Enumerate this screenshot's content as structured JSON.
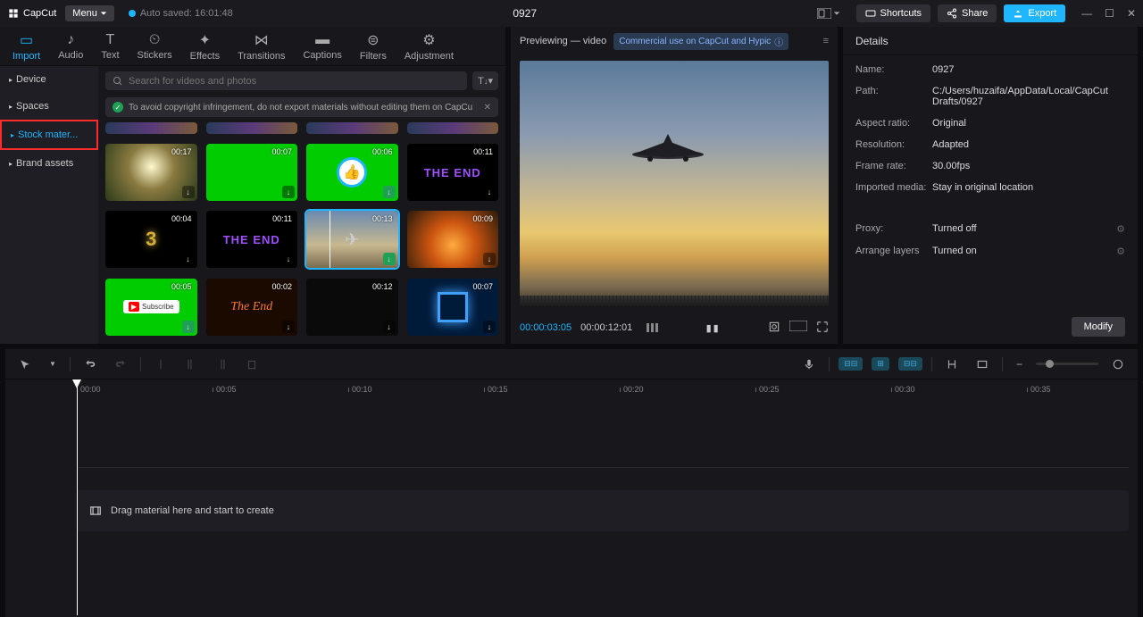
{
  "app": {
    "name": "CapCut"
  },
  "menu_label": "Menu",
  "autosave": "Auto saved: 16:01:48",
  "project_title": "0927",
  "top": {
    "shortcuts": "Shortcuts",
    "share": "Share",
    "export": "Export"
  },
  "tabs": [
    {
      "label": "Import",
      "active": true
    },
    {
      "label": "Audio"
    },
    {
      "label": "Text"
    },
    {
      "label": "Stickers"
    },
    {
      "label": "Effects"
    },
    {
      "label": "Transitions"
    },
    {
      "label": "Captions"
    },
    {
      "label": "Filters"
    },
    {
      "label": "Adjustment"
    }
  ],
  "sidebar": [
    {
      "label": "Device"
    },
    {
      "label": "Spaces"
    },
    {
      "label": "Stock mater...",
      "active": true,
      "highlighted": true
    },
    {
      "label": "Brand assets"
    }
  ],
  "search_placeholder": "Search for videos and photos",
  "copyright_warning": "To avoid copyright infringement, do not export materials without editing them on CapCu",
  "thumbs": [
    {
      "duration": "",
      "kind": "top-strip"
    },
    {
      "duration": "",
      "kind": "top-strip"
    },
    {
      "duration": "",
      "kind": "top-strip"
    },
    {
      "duration": "",
      "kind": "top-strip"
    },
    {
      "duration": "00:17",
      "kind": "forest"
    },
    {
      "duration": "00:07",
      "kind": "green"
    },
    {
      "duration": "00:06",
      "kind": "like",
      "dl_done": true
    },
    {
      "duration": "00:11",
      "kind": "theend-purple"
    },
    {
      "duration": "00:04",
      "kind": "countdown"
    },
    {
      "duration": "00:11",
      "kind": "theend-purple"
    },
    {
      "duration": "00:13",
      "kind": "airplane",
      "selected": true,
      "dl_done": true
    },
    {
      "duration": "00:09",
      "kind": "explosion"
    },
    {
      "duration": "00:05",
      "kind": "subscribe",
      "dl_done": true
    },
    {
      "duration": "00:02",
      "kind": "theend-orange"
    },
    {
      "duration": "00:12",
      "kind": "dark"
    },
    {
      "duration": "00:07",
      "kind": "bluesquare"
    }
  ],
  "preview": {
    "header": "Previewing — video",
    "commercial": "Commercial use on CapCut and Hypic",
    "time_current": "00:00:03:05",
    "time_total": "00:00:12:01"
  },
  "details": {
    "header": "Details",
    "rows": [
      {
        "label": "Name:",
        "value": "0927"
      },
      {
        "label": "Path:",
        "value": "C:/Users/huzaifa/AppData/Local/CapCut Drafts/0927"
      },
      {
        "label": "Aspect ratio:",
        "value": "Original"
      },
      {
        "label": "Resolution:",
        "value": "Adapted"
      },
      {
        "label": "Frame rate:",
        "value": "30.00fps"
      },
      {
        "label": "Imported media:",
        "value": "Stay in original location"
      }
    ],
    "rows2": [
      {
        "label": "Proxy:",
        "value": "Turned off",
        "gear": true
      },
      {
        "label": "Arrange layers",
        "value": "Turned on",
        "gear": true
      }
    ],
    "modify": "Modify"
  },
  "timeline": {
    "ruler": [
      "00:00",
      "00:05",
      "00:10",
      "00:15",
      "00:20",
      "00:25",
      "00:30",
      "00:35"
    ],
    "drag_hint": "Drag material here and start to create"
  }
}
